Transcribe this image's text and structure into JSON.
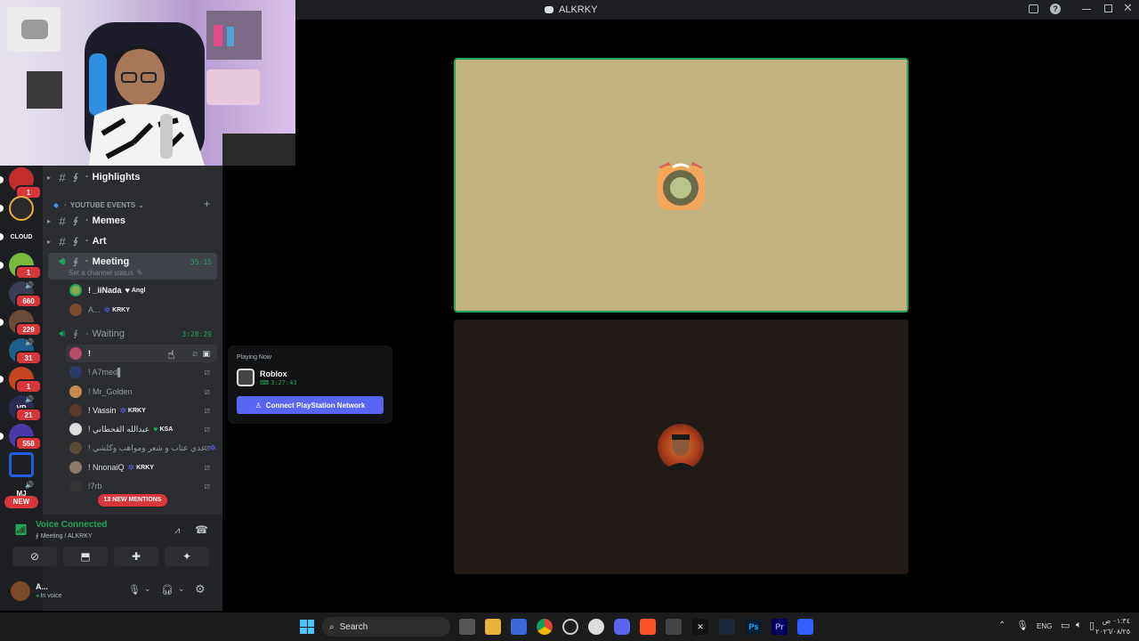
{
  "window": {
    "title": "ALKRKY"
  },
  "rail": {
    "badges": [
      "1",
      "660",
      "229",
      "31",
      "1",
      "21",
      "558"
    ],
    "new_label": "NEW",
    "servers": [
      "cloud-server",
      "sheikh-server",
      "fps-server",
      "vp-server",
      "mj-server"
    ],
    "cloud_label": "CLOUD",
    "vp_label": "VP",
    "mj_label": "MJ"
  },
  "channels": {
    "highlights": "Highlights",
    "category": "YOUTUBE EVENTS",
    "memes": "Memes",
    "art": "Art",
    "meeting": {
      "name": "Meeting",
      "time": "35:15",
      "status": "Set a channel status"
    },
    "meeting_users": [
      {
        "name": "! _iiNada",
        "tag": "Angl",
        "tag_icon": "♥"
      },
      {
        "name": "A...",
        "tag": "KRKY",
        "tag_icon": "✲"
      }
    ],
    "waiting": {
      "name": "Waiting",
      "time": "3:28:29"
    },
    "waiting_users": [
      {
        "name": "!",
        "tag": ""
      },
      {
        "name": "! A7med▌",
        "tag": ""
      },
      {
        "name": "! Mr_Golden",
        "tag": ""
      },
      {
        "name": "! Vassin",
        "tag": "KRKY",
        "tag_icon": "✲"
      },
      {
        "name": "! عبدالله القحطاني",
        "tag": "KSA",
        "tag_icon": "♥"
      },
      {
        "name": "! عدي عتاب و شعر ومواهب وكلشي",
        "tag": "",
        "tag_icon": "✲"
      },
      {
        "name": "! NnonaiQ",
        "tag": "KRKY",
        "tag_icon": "✲"
      },
      {
        "name": "!7rb",
        "tag": ""
      }
    ],
    "mentions": "13 NEW MENTIONS"
  },
  "voice": {
    "status": "Voice Connected",
    "location": "Meeting / ALKRKY"
  },
  "user": {
    "name": "A...",
    "status": "In voice"
  },
  "popout": {
    "header": "Playing Now",
    "game": "Roblox",
    "elapsed": "3:27:43",
    "connect": "Connect PlayStation Network"
  },
  "taskbar": {
    "search": "Search",
    "lang": "ENG",
    "time": "٠١:٣٤ ص",
    "date": "٢٠٢٦/٠٨/٢٥"
  },
  "colors": {
    "accent": "#5865f2",
    "voice_green": "#23a55a",
    "mention_red": "#da373c",
    "tile_top": "#c2b280",
    "tile_bottom": "#211a16"
  }
}
